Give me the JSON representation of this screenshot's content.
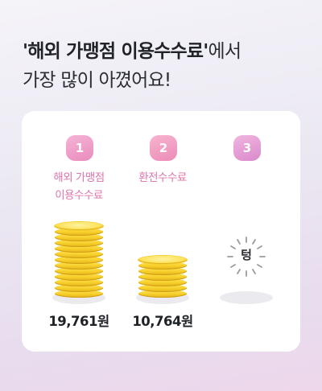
{
  "headline": {
    "quoted_category": "'해외 가맹점 이용수수료'",
    "suffix": "에서",
    "line2": "가장 많이 아꼈어요!"
  },
  "ranking": [
    {
      "rank": "1",
      "label_line1": "해외 가맹점",
      "label_line2": "이용수수료",
      "amount": "19,761원",
      "coin_count": 13
    },
    {
      "rank": "2",
      "label_line1": "환전수수료",
      "label_line2": "",
      "amount": "10,764원",
      "coin_count": 7
    },
    {
      "rank": "3",
      "label_line1": "",
      "label_line2": "",
      "amount": "",
      "empty_text": "텅",
      "coin_count": 0
    }
  ],
  "colors": {
    "accent_pink": "#dd74ab",
    "coin_gold": "#f6cf2a",
    "text_dark": "#1f2227"
  },
  "icons": {
    "rank1": "rank-badge",
    "coins": "coin-stack-icon",
    "empty": "empty-burst-icon"
  }
}
